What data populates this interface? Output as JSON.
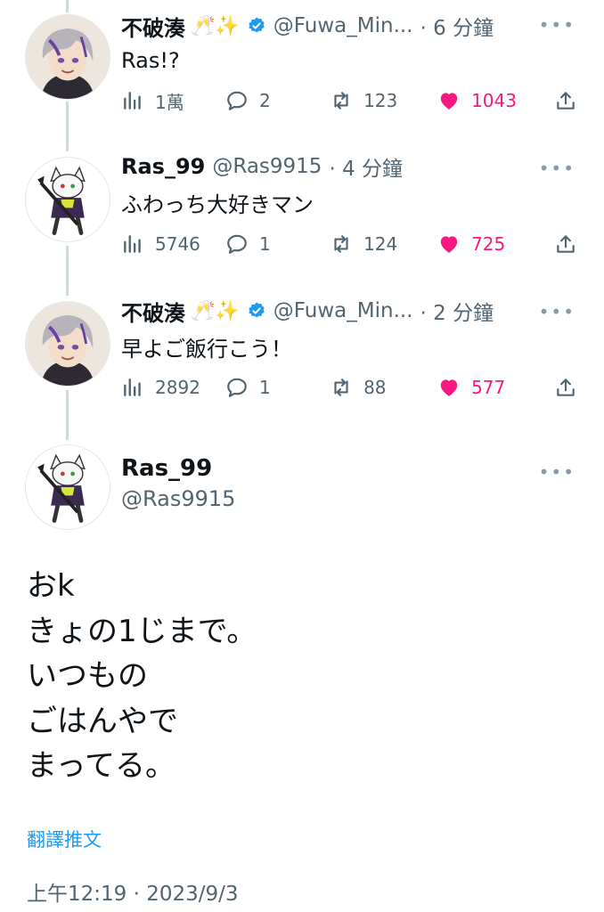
{
  "tweets": [
    {
      "name": "不破湊",
      "emoji": "🥂✨",
      "verified": true,
      "handle": "@Fuwa_Min...",
      "time": "· 6 分鐘",
      "text": "Ras!?",
      "views": "1萬",
      "replies": "2",
      "retweets": "123",
      "likes": "1043",
      "avatar": "fuwa-avatar"
    },
    {
      "name": "Ras_99",
      "handle": "@Ras9915",
      "time": "· 4 分鐘",
      "text": "ふわっち大好きマン",
      "views": "5746",
      "replies": "1",
      "retweets": "124",
      "likes": "725",
      "avatar": "ras-cat-avatar"
    },
    {
      "name": "不破湊",
      "emoji": "🥂✨",
      "verified": true,
      "handle": "@Fuwa_Min...",
      "time": "· 2 分鐘",
      "text": "早よご飯行こう！",
      "views": "2892",
      "replies": "1",
      "retweets": "88",
      "likes": "577",
      "avatar": "fuwa-avatar"
    }
  ],
  "main_tweet": {
    "name": "Ras_99",
    "handle": "@Ras9915",
    "lines": [
      "おk",
      "きょの1じまで。",
      "いつもの",
      "ごはんやで",
      "まってる。"
    ],
    "translate_label": "翻譯推文",
    "timestamp": "上午12:19 · 2023/9/3"
  },
  "colors": {
    "like": "#f91880",
    "link": "#1d9bf0",
    "secondary": "#536471",
    "verified": "#1d9bf0"
  },
  "icons": [
    "views-icon",
    "reply-icon",
    "retweet-icon",
    "heart-icon",
    "share-icon",
    "more-icon",
    "verified-icon"
  ]
}
